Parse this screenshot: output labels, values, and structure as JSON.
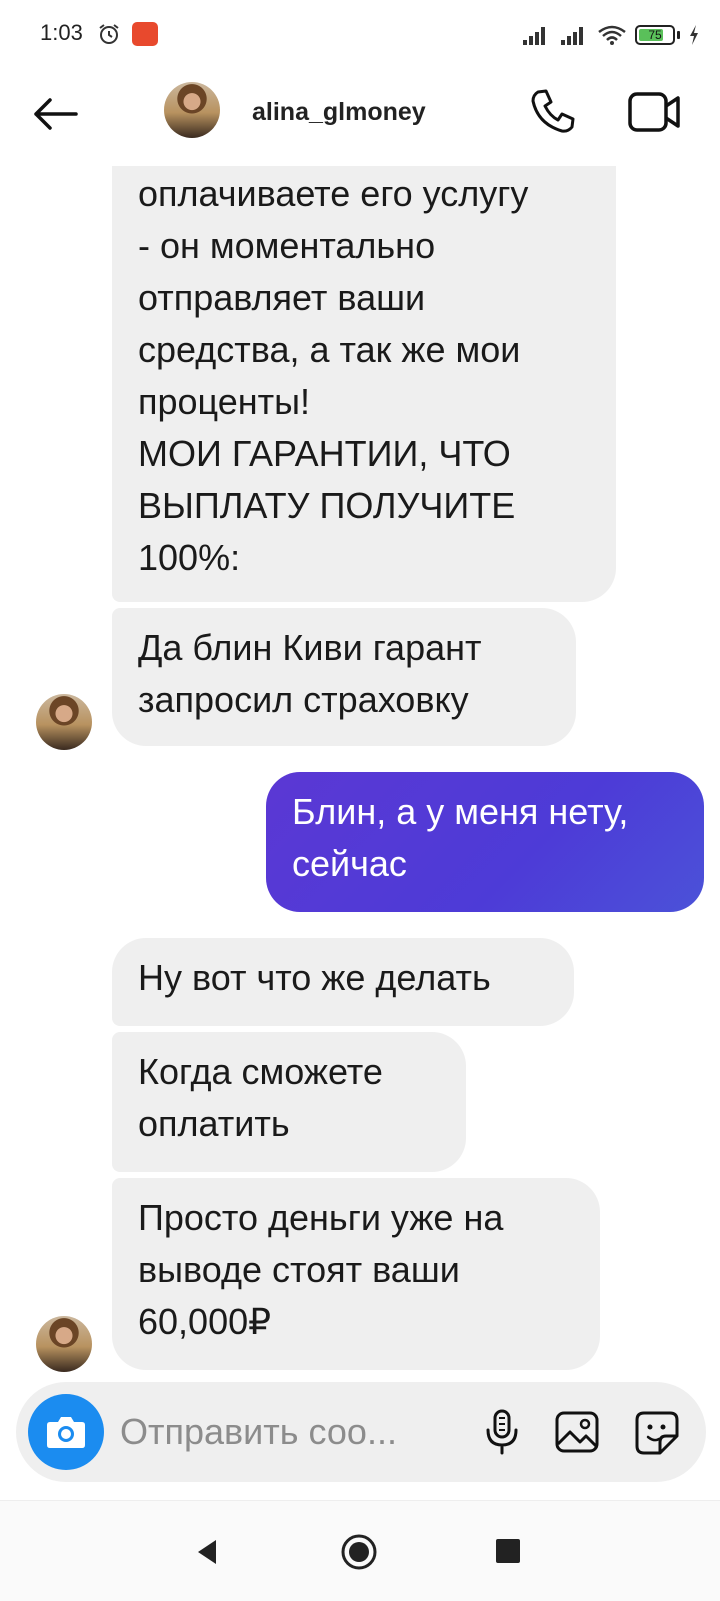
{
  "status_bar": {
    "time": "1:03",
    "battery_level": "75",
    "battery_fraction": 0.75,
    "app_icon": "aliexpress-icon"
  },
  "header": {
    "username": "alina_glmoney",
    "back_icon": "arrow-left-icon",
    "call_icon": "phone-icon",
    "video_icon": "video-camera-icon"
  },
  "messages": [
    {
      "from": "them",
      "text": "оплачиваете его услугу\n- он моментально\nотправляет ваши\nсредства, а так же мои\nпроценты!\nМОИ ГАРАНТИИ, ЧТО\nВЫПЛАТУ ПОЛУЧИТЕ\n100%:"
    },
    {
      "from": "them",
      "text": "Да блин Киви гарант\nзапросил страховку"
    },
    {
      "from": "me",
      "text": "Блин, а у меня нету,\nсейчас"
    },
    {
      "from": "them",
      "text": "Ну вот что же делать"
    },
    {
      "from": "them",
      "text": "Когда сможете\nоплатить"
    },
    {
      "from": "them",
      "text": "Просто деньги уже на\nвыводе стоят ваши\n60,000₽"
    }
  ],
  "composer": {
    "placeholder": "Отправить соо...",
    "camera_icon": "camera-icon",
    "mic_icon": "microphone-icon",
    "gallery_icon": "image-icon",
    "sticker_icon": "sticker-icon"
  },
  "colors": {
    "sent_bubble": "#4d3bd7",
    "received_bubble": "#efefef",
    "camera_button": "#1b8cf0"
  }
}
